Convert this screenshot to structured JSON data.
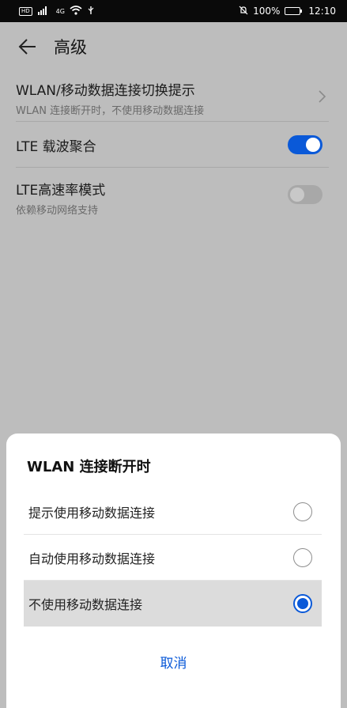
{
  "status_bar": {
    "left_badge": "HD",
    "signal": "4G",
    "battery_text": "100%",
    "time": "12:10",
    "icons": [
      "hd-icon",
      "signal-icon",
      "wifi-icon",
      "usb-icon",
      "mute-icon",
      "battery-icon"
    ]
  },
  "header": {
    "title": "高级",
    "back_icon": "arrow-left-icon"
  },
  "settings": [
    {
      "title": "WLAN/移动数据连接切换提示",
      "subtitle": "WLAN 连接断开时，不使用移动数据连接",
      "control": "chevron"
    },
    {
      "title": "LTE 载波聚合",
      "control": "toggle",
      "enabled": true
    },
    {
      "title": "LTE高速率模式",
      "subtitle": "依赖移动网络支持",
      "control": "toggle",
      "enabled": false
    }
  ],
  "dialog": {
    "title": "WLAN 连接断开时",
    "options": [
      {
        "label": "提示使用移动数据连接",
        "selected": false
      },
      {
        "label": "自动使用移动数据连接",
        "selected": false
      },
      {
        "label": "不使用移动数据连接",
        "selected": true
      }
    ],
    "cancel_label": "取消"
  },
  "colors": {
    "accent": "#0a59d8",
    "overlay_background": "#bdbdbd",
    "status_bar": "#0a0a0a"
  }
}
